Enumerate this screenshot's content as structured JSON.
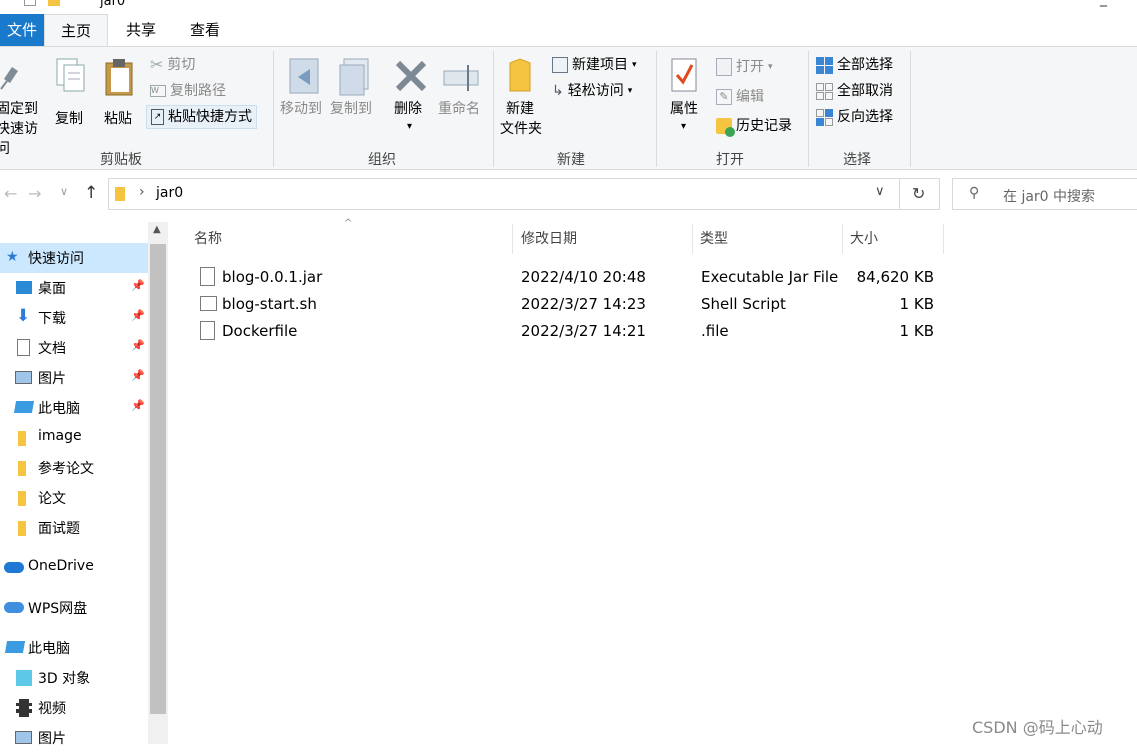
{
  "window": {
    "title": "jar0"
  },
  "tabs": {
    "file": "文件",
    "home": "主页",
    "share": "共享",
    "view": "查看"
  },
  "ribbon": {
    "clipboard": {
      "group": "剪贴板",
      "pin_line1": "固定到",
      "pin_line2": "快速访问",
      "copy": "复制",
      "paste": "粘贴",
      "cut": "剪切",
      "copy_path": "复制路径",
      "paste_shortcut": "粘贴快捷方式"
    },
    "organize": {
      "group": "组织",
      "move_to": "移动到",
      "copy_to": "复制到",
      "delete": "删除",
      "rename": "重命名"
    },
    "new": {
      "group": "新建",
      "new_folder_line1": "新建",
      "new_folder_line2": "文件夹",
      "new_item": "新建项目",
      "easy_access": "轻松访问"
    },
    "open": {
      "group": "打开",
      "properties": "属性",
      "open": "打开",
      "edit": "编辑",
      "history": "历史记录"
    },
    "select": {
      "group": "选择",
      "select_all": "全部选择",
      "select_none": "全部取消",
      "invert": "反向选择"
    }
  },
  "address": {
    "path": "jar0",
    "search_placeholder": "在 jar0 中搜索"
  },
  "nav": {
    "quick_access": "快速访问",
    "items": [
      "桌面",
      "下载",
      "文档",
      "图片",
      "此电脑",
      "image",
      "参考论文",
      "论文",
      "面试题"
    ],
    "onedrive": "OneDrive",
    "wps": "WPS网盘",
    "this_pc": "此电脑",
    "pc_items": [
      "3D 对象",
      "视频",
      "图片"
    ]
  },
  "columns": {
    "name": "名称",
    "date": "修改日期",
    "type": "类型",
    "size": "大小"
  },
  "files": [
    {
      "name": "blog-0.0.1.jar",
      "date": "2022/4/10 20:48",
      "type": "Executable Jar File",
      "size": "84,620 KB"
    },
    {
      "name": "blog-start.sh",
      "date": "2022/3/27 14:23",
      "type": "Shell Script",
      "size": "1 KB"
    },
    {
      "name": "Dockerfile",
      "date": "2022/3/27 14:21",
      "type": ".file",
      "size": "1 KB"
    }
  ],
  "watermark": "CSDN @码上心动",
  "colors": {
    "accent": "#1979ca",
    "folder": "#f5c542",
    "ribbon_bg": "#f5f6f7"
  }
}
